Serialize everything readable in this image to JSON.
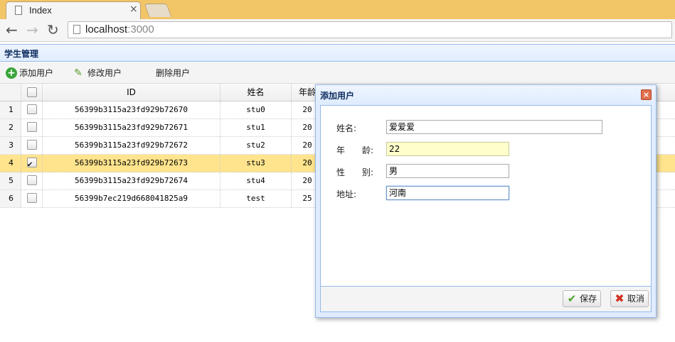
{
  "browser": {
    "tab_title": "Index",
    "tab_close": "×",
    "url_host": "localhost",
    "url_port": ":3000",
    "back_icon": "←",
    "forward_icon": "→",
    "reload_icon": "↻"
  },
  "panel": {
    "title": "学生管理"
  },
  "toolbar": {
    "add_label": "添加用户",
    "edit_label": "修改用户",
    "delete_label": "删除用户"
  },
  "grid": {
    "columns": [
      "ID",
      "姓名",
      "年龄"
    ],
    "rows": [
      {
        "num": "1",
        "id": "56399b3115a23fd929b72670",
        "name": "stu0",
        "age": "20",
        "checked": false
      },
      {
        "num": "2",
        "id": "56399b3115a23fd929b72671",
        "name": "stu1",
        "age": "20",
        "checked": false
      },
      {
        "num": "3",
        "id": "56399b3115a23fd929b72672",
        "name": "stu2",
        "age": "20",
        "checked": false
      },
      {
        "num": "4",
        "id": "56399b3115a23fd929b72673",
        "name": "stu3",
        "age": "20",
        "checked": true
      },
      {
        "num": "5",
        "id": "56399b3115a23fd929b72674",
        "name": "stu4",
        "age": "20",
        "checked": false
      },
      {
        "num": "6",
        "id": "56399b7ec219d668041825a9",
        "name": "test",
        "age": "25",
        "checked": false
      }
    ]
  },
  "dialog": {
    "title": "添加用户",
    "close_icon": "×",
    "fields": {
      "name_label": "姓名:",
      "name_value": "爱爱爱",
      "age_label": "年　　龄:",
      "age_value": "22",
      "gender_label": "性　　别:",
      "gender_value": "男",
      "address_label": "地址:",
      "address_value": "河南"
    },
    "save_label": "保存",
    "cancel_label": "取消"
  }
}
